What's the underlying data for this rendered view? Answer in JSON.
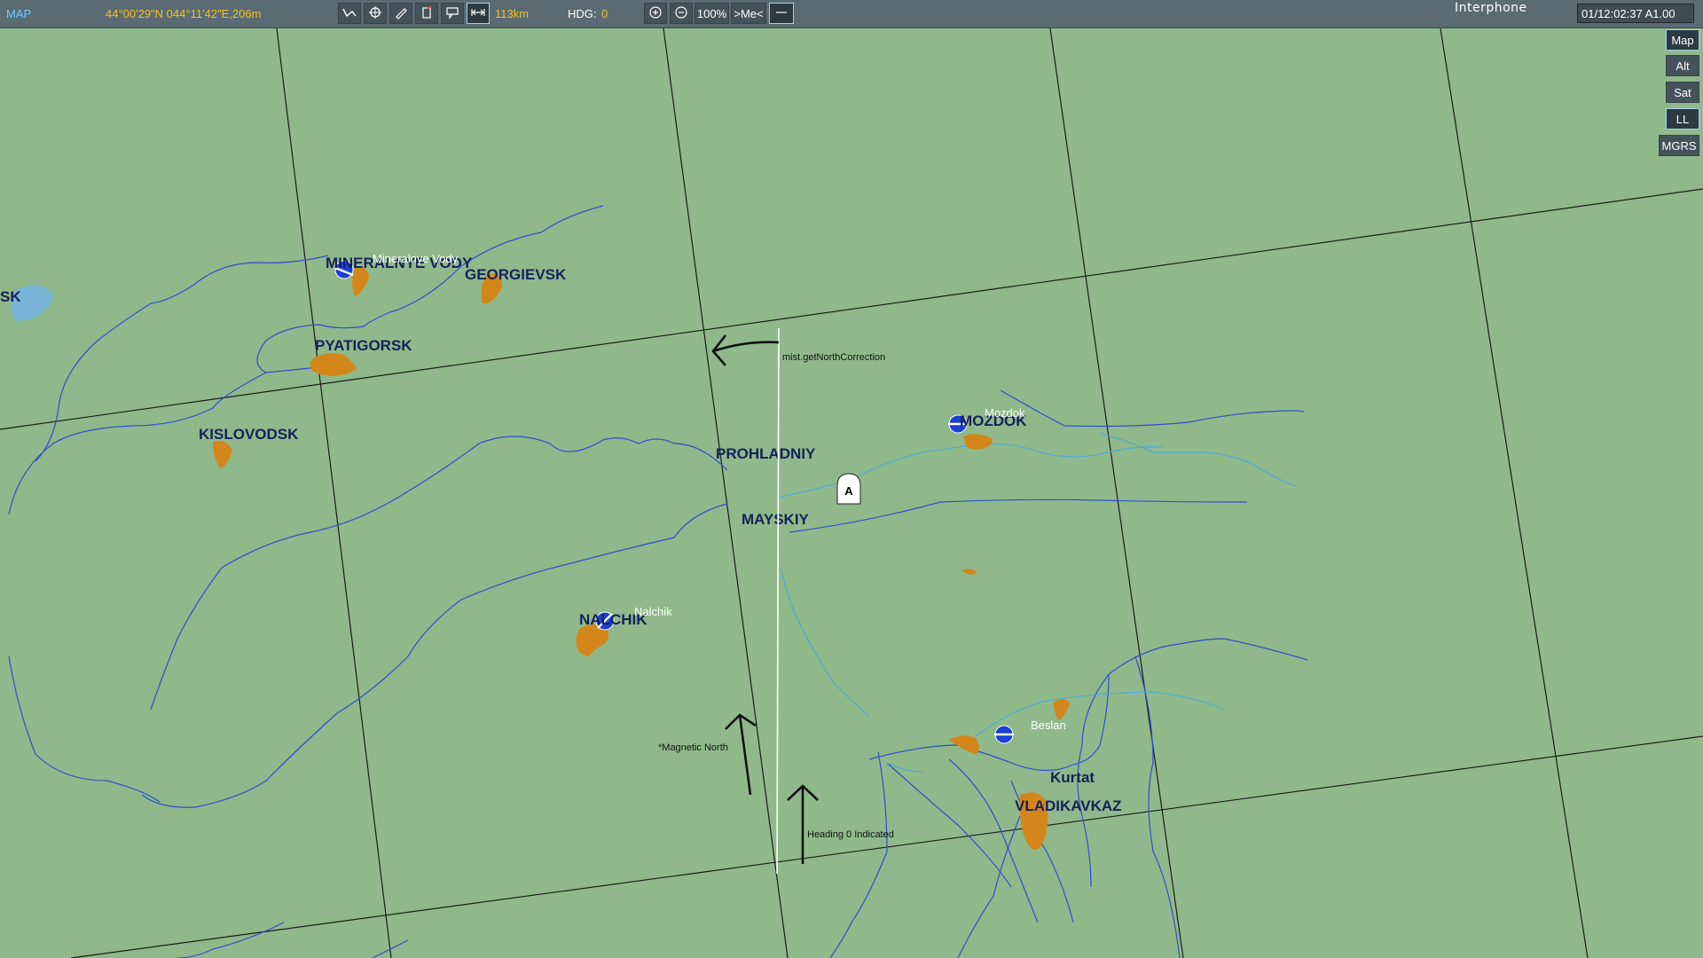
{
  "toolbar": {
    "map_label": "MAP",
    "coordinates": "44°00'29\"N 044°11'42\"E,206m",
    "ruler_distance": "113km",
    "heading_label": "HDG:",
    "heading_value": "0",
    "zoom_level": "100%",
    "center_me_label": ">Me<",
    "interphone_label": "Interphone",
    "clock": "01/12:02:37 A1.00",
    "colors": {
      "accent": "#6ccbff",
      "value": "#f2c21b",
      "active_border": "#9fd3ea"
    }
  },
  "side_buttons": [
    {
      "label": "Map",
      "active": true
    },
    {
      "label": "Alt",
      "active": false
    },
    {
      "label": "Sat",
      "active": false
    },
    {
      "label": "LL",
      "active": true
    },
    {
      "label": "MGRS",
      "active": false
    }
  ],
  "map": {
    "cities": [
      "SK",
      "MINERALNYE VODY",
      "GEORGIEVSK",
      "PYATIGORSK",
      "KISLOVODSK",
      "PROHLADNIY",
      "MAYSKIY",
      "NALCHIK",
      "MOZDOK",
      "Kurtat",
      "VLADIKAVKAZ"
    ],
    "airfields": [
      "Mineralnye Vody",
      "Mozdok",
      "Nalchik",
      "Beslan"
    ],
    "unit_marker": "A",
    "annotations": {
      "north_correction": "mist.getNorthCorrection",
      "magnetic_north": "*Magnetic North",
      "heading_zero": "Heading 0 Indicated"
    }
  }
}
